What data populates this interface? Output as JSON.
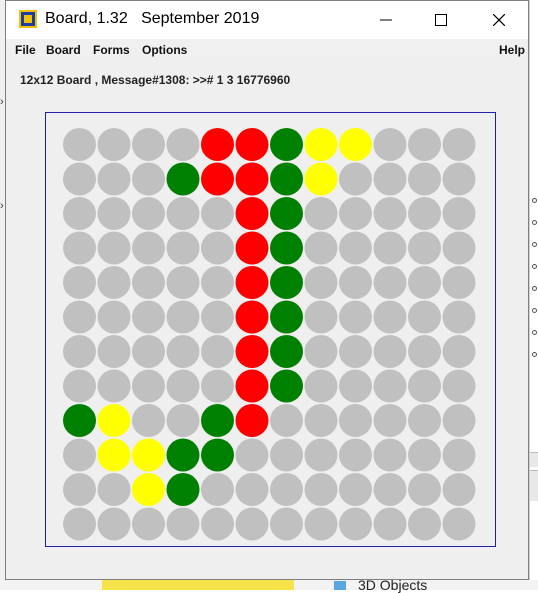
{
  "window": {
    "title": "Board, 1.32   September 2019",
    "icon": "board-grid-icon",
    "controls": [
      "minimize-icon",
      "maximize-icon",
      "close-icon"
    ]
  },
  "menu": {
    "file": "File",
    "board": "Board",
    "forms": "Forms",
    "options": "Options",
    "help": "Help"
  },
  "message": "12x12 Board , Message#1308: >># 1 3 16776960",
  "board": {
    "rows": 12,
    "cols": 12,
    "palette": {
      ".": "#c0c0c0",
      "R": "#ff0000",
      "G": "#008000",
      "Y": "#ffff00"
    },
    "cells": [
      "....RRGYY...",
      "...GRRGY....",
      ".....RG.....",
      ".....RG.....",
      ".....RG.....",
      ".....RG.....",
      ".....RG.....",
      ".....RG.....",
      "GY..GR......",
      ".YYGG.......",
      "..YG........",
      "............"
    ]
  },
  "background": {
    "taskbar_label": "3D Objects"
  }
}
